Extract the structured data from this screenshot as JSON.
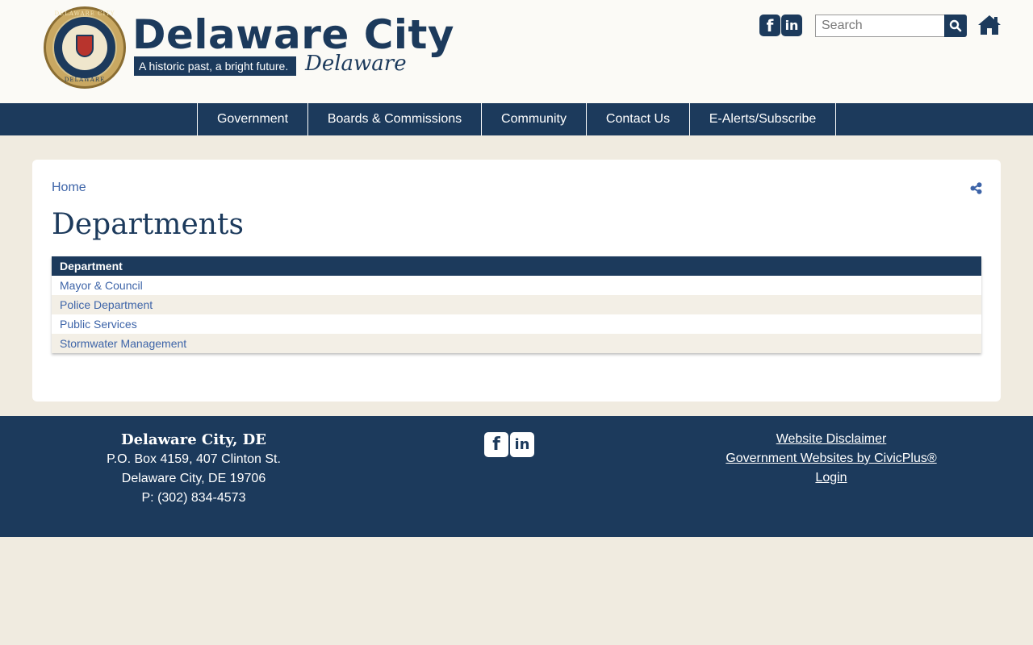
{
  "header": {
    "site_title": "Delaware City",
    "tagline": "A historic past, a bright future.",
    "script_text": "Delaware",
    "seal_top": "DELAWARE CITY",
    "seal_bottom": "DELAWARE",
    "social": {
      "facebook": "f",
      "linkedin": "in"
    },
    "search": {
      "placeholder": "Search"
    },
    "icons": [
      "facebook-icon",
      "linkedin-icon",
      "search-icon",
      "home-icon"
    ]
  },
  "nav": {
    "items": [
      {
        "label": "Government"
      },
      {
        "label": "Boards & Commissions"
      },
      {
        "label": "Community"
      },
      {
        "label": "Contact Us"
      },
      {
        "label": "E-Alerts/Subscribe"
      }
    ]
  },
  "main": {
    "breadcrumb": "Home",
    "title": "Departments",
    "table": {
      "header": "Department",
      "rows": [
        "Mayor & Council",
        "Police Department",
        "Public Services",
        "Stormwater Management"
      ]
    }
  },
  "footer": {
    "name": "Delaware City, DE",
    "address1": "P.O. Box 4159, 407 Clinton St.",
    "address2": "Delaware City, DE 19706",
    "phone": "P: (302) 834-4573",
    "social": {
      "facebook": "f",
      "linkedin": "in"
    },
    "links": [
      "Website Disclaimer",
      "Government Websites by CivicPlus®",
      "Login"
    ]
  },
  "colors": {
    "navy": "#1c3a5c",
    "background": "#f0ebe0",
    "link": "#3d64a8",
    "row_alt": "#f3efe6"
  }
}
